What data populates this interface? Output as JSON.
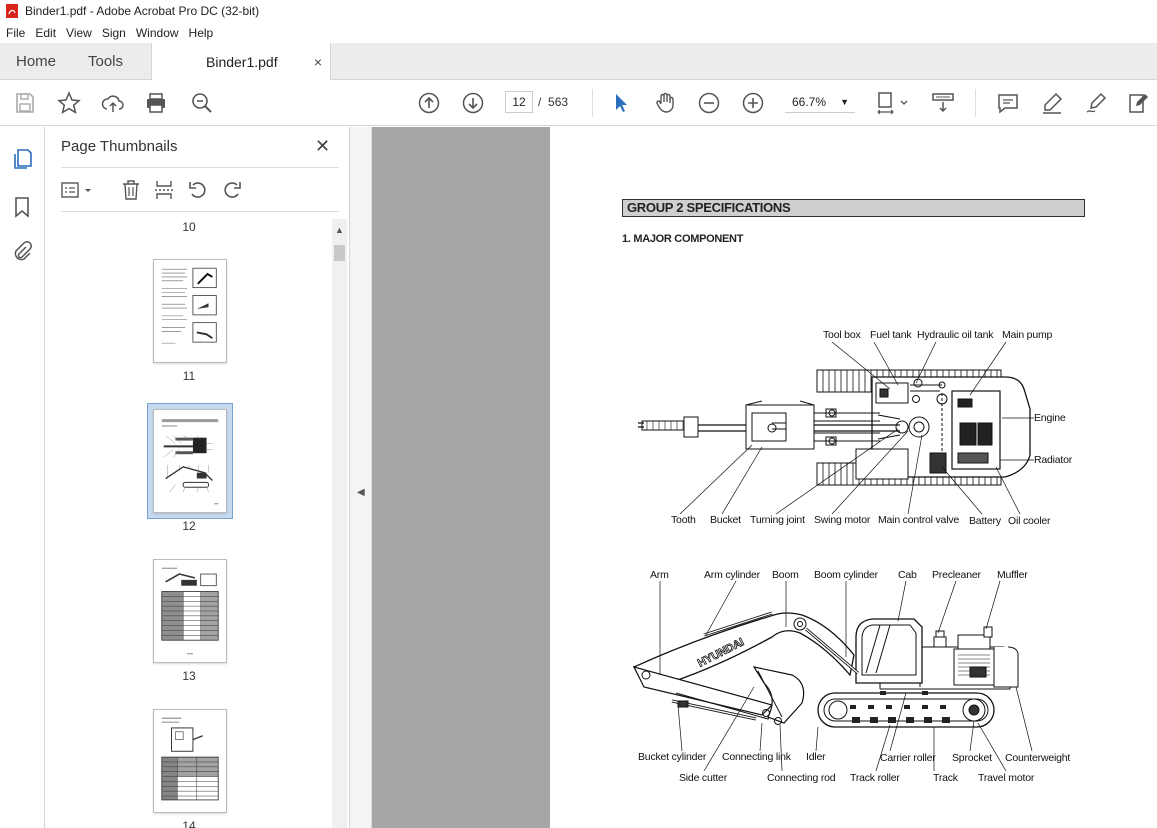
{
  "window": {
    "title": "Binder1.pdf - Adobe Acrobat Pro DC (32-bit)"
  },
  "menu": [
    "File",
    "Edit",
    "View",
    "Sign",
    "Window",
    "Help"
  ],
  "tabs": {
    "home": "Home",
    "tools": "Tools",
    "doc": "Binder1.pdf",
    "close": "×"
  },
  "nav": {
    "current_page": "12",
    "separator": "/",
    "total_pages": "563",
    "zoom": "66.7%"
  },
  "panel": {
    "title": "Page Thumbnails",
    "close": "✕",
    "thumbs": [
      {
        "label": "10"
      },
      {
        "label": "11"
      },
      {
        "label": "12",
        "selected": true
      },
      {
        "label": "13"
      },
      {
        "label": "14"
      }
    ]
  },
  "document": {
    "heading": "GROUP  2  SPECIFICATIONS",
    "subheading": "1.  MAJOR COMPONENT",
    "top_labels": {
      "tool_box": "Tool box",
      "fuel_tank": "Fuel tank",
      "hydraulic_oil_tank": "Hydraulic oil tank",
      "main_pump": "Main pump",
      "engine": "Engine",
      "radiator": "Radiator",
      "tooth": "Tooth",
      "bucket": "Bucket",
      "turning_joint": "Turning joint",
      "swing_motor": "Swing motor",
      "main_control_valve": "Main control valve",
      "battery": "Battery",
      "oil_cooler": "Oil cooler"
    },
    "side_labels": {
      "arm": "Arm",
      "arm_cylinder": "Arm cylinder",
      "boom": "Boom",
      "boom_cylinder": "Boom cylinder",
      "cab": "Cab",
      "precleaner": "Precleaner",
      "muffler": "Muffler",
      "bucket_cylinder": "Bucket cylinder",
      "connecting_link": "Connecting link",
      "idler": "Idler",
      "carrier_roller": "Carrier roller",
      "sprocket": "Sprocket",
      "counterweight": "Counterweight",
      "side_cutter": "Side cutter",
      "connecting_rod": "Connecting rod",
      "track_roller": "Track roller",
      "track": "Track",
      "travel_motor": "Travel motor"
    },
    "brand_on_boom": "HYUNDAI"
  },
  "colors": {
    "adobe_red": "#d7261e",
    "select_blue": "#2a6ebb",
    "heading_bg": "#cfcfcf",
    "viewer_bg": "#a6a6a6"
  }
}
